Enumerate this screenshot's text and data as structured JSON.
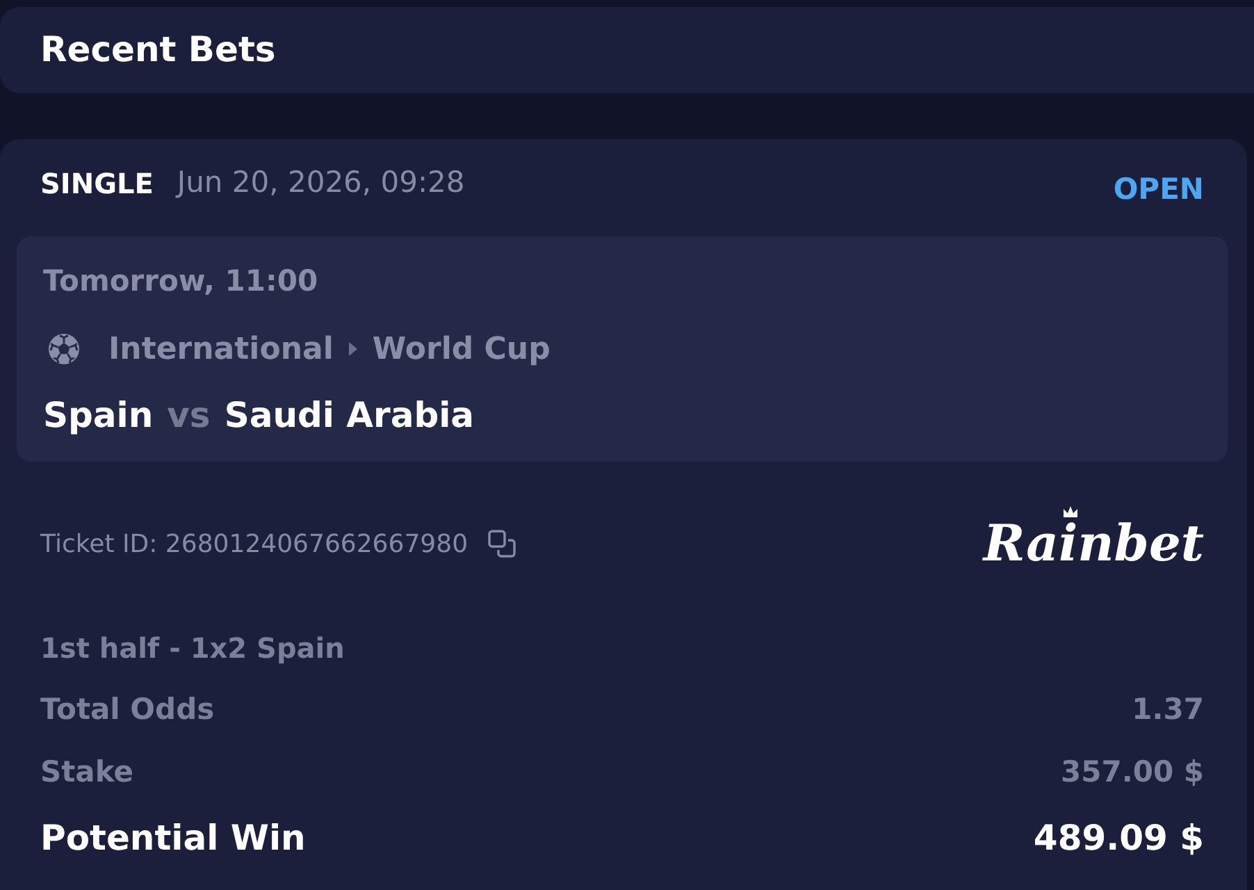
{
  "header": {
    "title": "Recent Bets"
  },
  "bet": {
    "type": "SINGLE",
    "placed_at": "Jun 20, 2026, 09:28",
    "status": "OPEN",
    "event": {
      "start_time": "Tomorrow, 11:00",
      "breadcrumb": [
        "International",
        "World Cup"
      ],
      "home_team": "Spain",
      "versus": "vs",
      "away_team": "Saudi Arabia"
    },
    "ticket_id": "Ticket ID: 2680124067662667980",
    "brand": "Rainbet",
    "selection": "1st half - 1x2 Spain",
    "summary": [
      {
        "kind": "line",
        "label": "Total Odds",
        "value": "1.37"
      },
      {
        "kind": "line",
        "label": "Stake",
        "value": "357.00 $"
      },
      {
        "kind": "total",
        "label": "Potential Win",
        "value": "489.09 $"
      }
    ]
  }
}
